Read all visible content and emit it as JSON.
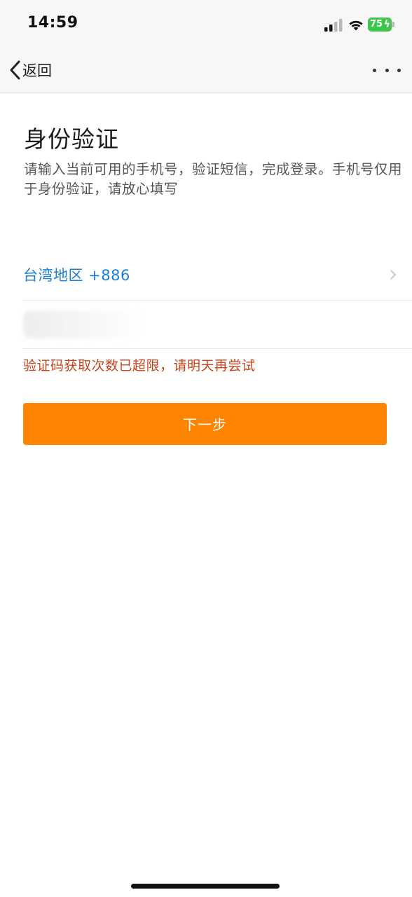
{
  "status_bar": {
    "time": "14:59",
    "battery_level": "75",
    "battery_charging": true,
    "signal_icon": "cellular-signal-icon",
    "wifi_icon": "wifi-icon",
    "battery_color": "#3cc74a"
  },
  "nav": {
    "back_label": "返回",
    "back_icon": "chevron-left-icon",
    "more_icon": "more-dots-icon"
  },
  "page": {
    "title": "身份验证",
    "subtitle": "请输入当前可用的手机号，验证短信，完成登录。手机号仅用于身份验证，请放心填写"
  },
  "form": {
    "region_label": "台湾地区 +886",
    "region_chevron_icon": "chevron-right-icon",
    "phone_value": "",
    "error_message": "验证码获取次数已超限，请明天再尝试",
    "next_button_label": "下一步"
  },
  "colors": {
    "accent": "#ff8401",
    "link": "#1b7fd8",
    "error": "#c9431c"
  }
}
